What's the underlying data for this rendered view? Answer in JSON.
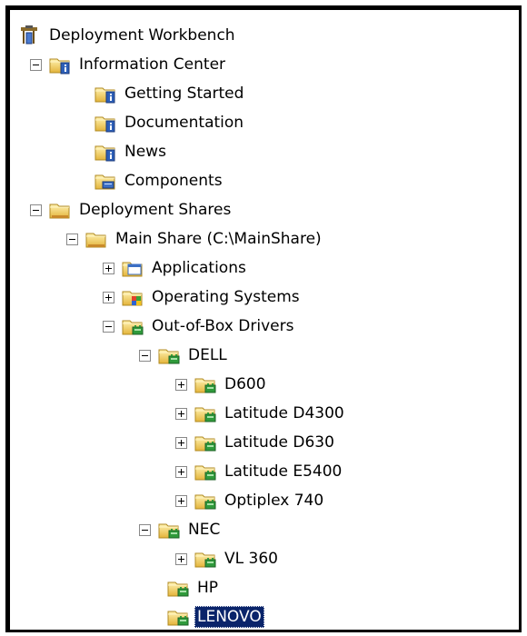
{
  "tree": {
    "root": {
      "label": "Deployment Workbench",
      "icon": "workbench-icon"
    },
    "information_center": {
      "label": "Information Center",
      "icon": "info-folder-icon"
    },
    "getting_started": {
      "label": "Getting Started",
      "icon": "info-folder-icon"
    },
    "documentation": {
      "label": "Documentation",
      "icon": "info-folder-icon"
    },
    "news": {
      "label": "News",
      "icon": "info-folder-icon"
    },
    "components": {
      "label": "Components",
      "icon": "components-folder-icon"
    },
    "deployment_shares": {
      "label": "Deployment Shares",
      "icon": "share-folder-icon"
    },
    "main_share": {
      "label": "Main Share (C:\\MainShare)",
      "icon": "share-folder-icon"
    },
    "applications": {
      "label": "Applications",
      "icon": "applications-folder-icon"
    },
    "operating_systems": {
      "label": "Operating Systems",
      "icon": "os-folder-icon"
    },
    "out_of_box_drivers": {
      "label": "Out-of-Box Drivers",
      "icon": "drivers-folder-icon"
    },
    "dell": {
      "label": "DELL",
      "icon": "drivers-folder-icon"
    },
    "d600": {
      "label": "D600",
      "icon": "drivers-folder-icon"
    },
    "latitude_d4300": {
      "label": "Latitude D4300",
      "icon": "drivers-folder-icon"
    },
    "latitude_d630": {
      "label": "Latitude D630",
      "icon": "drivers-folder-icon"
    },
    "latitude_e5400": {
      "label": "Latitude E5400",
      "icon": "drivers-folder-icon"
    },
    "optiplex_740": {
      "label": "Optiplex 740",
      "icon": "drivers-folder-icon"
    },
    "nec": {
      "label": "NEC",
      "icon": "drivers-folder-icon"
    },
    "vl_360": {
      "label": "VL 360",
      "icon": "drivers-folder-icon"
    },
    "hp": {
      "label": "HP",
      "icon": "drivers-folder-icon"
    },
    "lenovo": {
      "label": "LENOVO",
      "icon": "drivers-folder-icon",
      "selected": true
    }
  },
  "colors": {
    "selection_bg": "#0a246a",
    "selection_fg": "#ffffff",
    "folder_yellow": "#f2cf5b",
    "info_blue": "#2c5fb8",
    "driver_green": "#2f9a3b"
  }
}
